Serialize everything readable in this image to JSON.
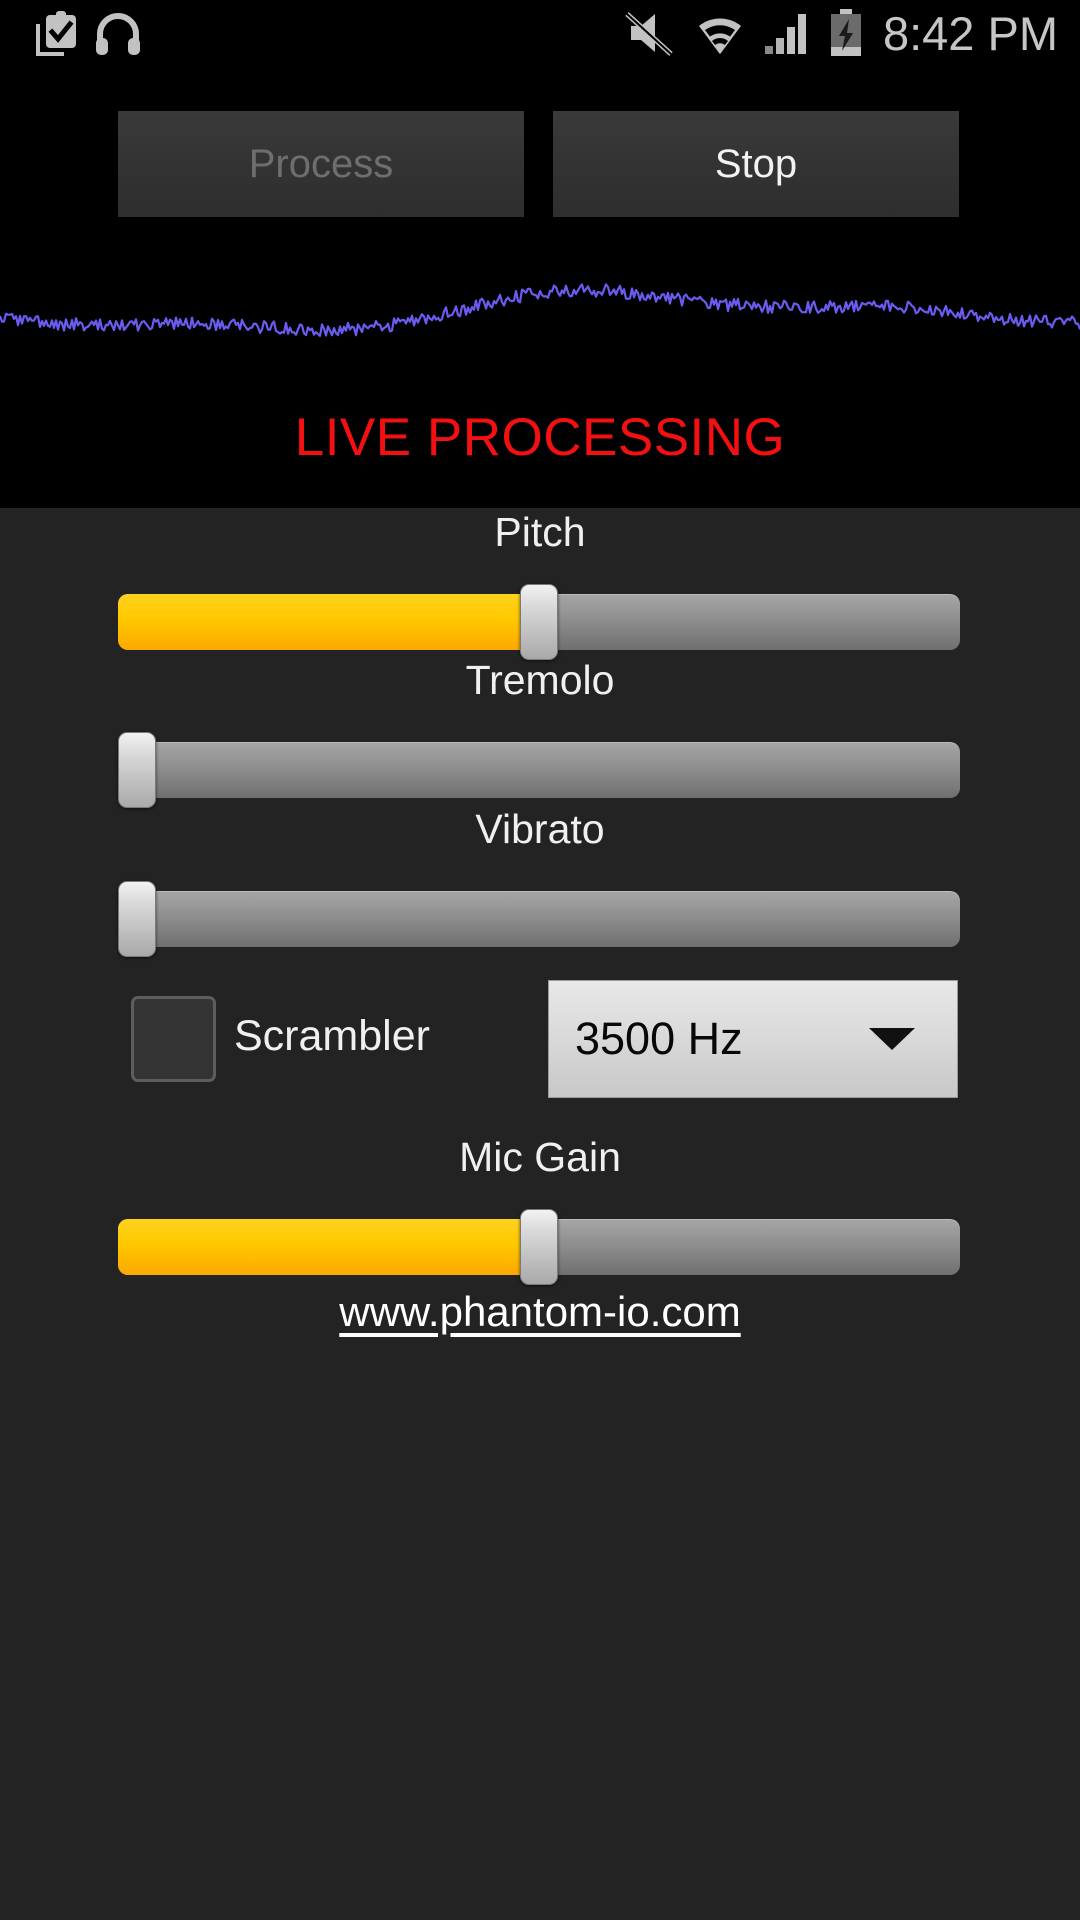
{
  "status_bar": {
    "time": "8:42 PM",
    "left_icons": [
      {
        "name": "clipboard-check-icon"
      },
      {
        "name": "headphones-icon"
      }
    ],
    "right_icons": [
      {
        "name": "volume-mute-icon"
      },
      {
        "name": "wifi-icon"
      },
      {
        "name": "cellular-signal-icon"
      },
      {
        "name": "battery-charging-icon"
      }
    ]
  },
  "toolbar": {
    "process_label": "Process",
    "process_enabled": false,
    "stop_label": "Stop",
    "stop_enabled": true
  },
  "visualizer": {
    "waveform_color": "#6a5cf0",
    "background_color": "#000000"
  },
  "status": {
    "live_text": "LIVE PROCESSING",
    "live_color": "#f41010"
  },
  "controls": {
    "sliders": [
      {
        "label": "Pitch",
        "value": 50,
        "fill_color": "#ffc800"
      },
      {
        "label": "Tremolo",
        "value": 0,
        "fill_color": "#ffc800"
      },
      {
        "label": "Vibrato",
        "value": 0,
        "fill_color": "#ffc800"
      },
      {
        "label": "Mic Gain",
        "value": 50,
        "fill_color": "#ffc800"
      }
    ],
    "scrambler": {
      "label": "Scrambler",
      "checked": false
    },
    "frequency": {
      "selected": "3500 Hz",
      "arrow": "chevron-down-icon"
    }
  },
  "footer": {
    "website": "www.phantom-io.com"
  }
}
